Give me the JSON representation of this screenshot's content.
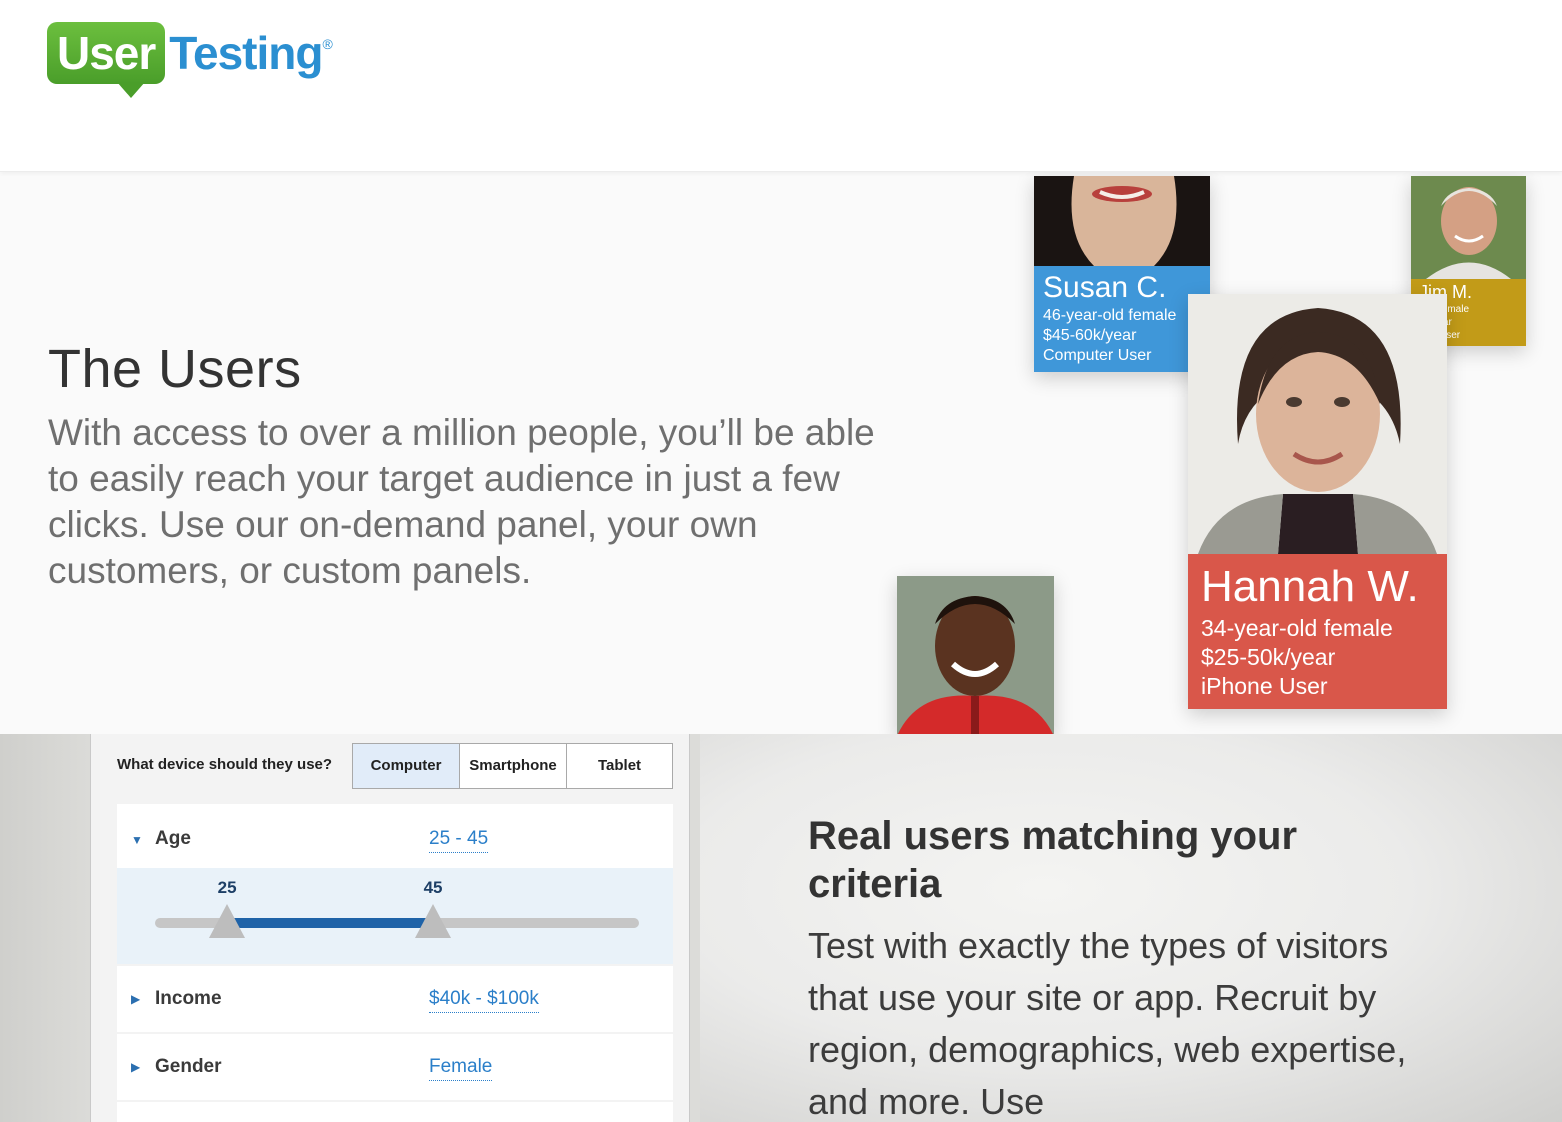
{
  "header": {
    "logo_user": "User",
    "logo_testing": "Testing",
    "logo_reg": "®"
  },
  "hero": {
    "title": "The Users",
    "text": "With access to over a million people, you’ll be able to easily reach your target audience in just a few clicks. Use our on-demand panel, your own customers, or custom panels."
  },
  "profiles": {
    "susan": {
      "name": "Susan C.",
      "line1": "46-year-old female",
      "line2": "$45-60k/year",
      "line3": "Computer User",
      "color": "#3f97d9"
    },
    "jim": {
      "name": "Jim M.",
      "line1": "ar-old male",
      "line2": "0k/year",
      "line3": "uter User",
      "color": "#c29b18"
    },
    "hannah": {
      "name": "Hannah W.",
      "line1": "34-year-old female",
      "line2": "$25-50k/year",
      "line3": "iPhone User",
      "color": "#d9574a"
    }
  },
  "panel": {
    "device_question": "What device should they use?",
    "devices": [
      "Computer",
      "Smartphone",
      "Tablet"
    ],
    "selected_device": "Computer",
    "age": {
      "label": "Age",
      "value": "25 - 45",
      "min": 25,
      "max": 45,
      "min_label": "25",
      "max_label": "45"
    },
    "income": {
      "label": "Income",
      "value": "$40k - $100k"
    },
    "gender": {
      "label": "Gender",
      "value": "Female"
    }
  },
  "section": {
    "title": "Real users matching your criteria",
    "text": "Test with exactly the types of visitors that use your site or app. Recruit by region, demographics, web expertise, and more. Use"
  }
}
